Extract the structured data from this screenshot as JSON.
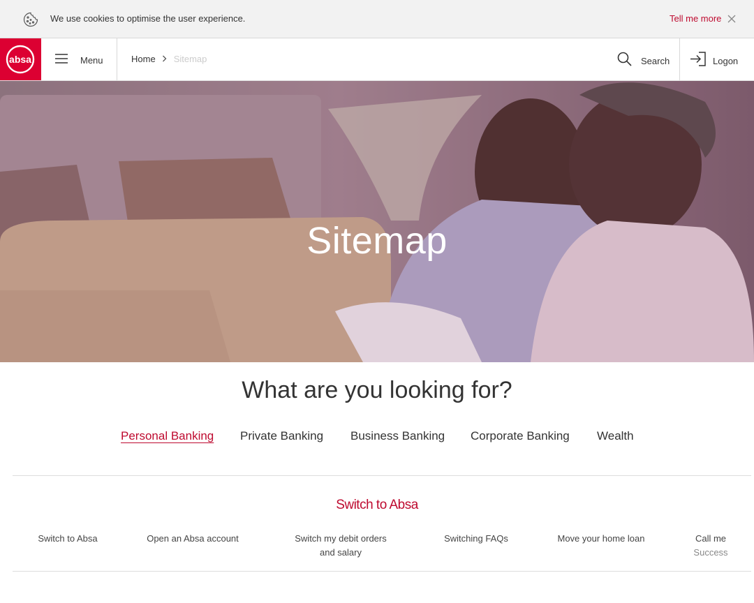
{
  "cookie": {
    "message": "We use cookies to optimise the user experience.",
    "tell_more": "Tell me more"
  },
  "header": {
    "logo_text": "absa",
    "menu_label": "Menu",
    "breadcrumb": {
      "home": "Home",
      "current": "Sitemap"
    },
    "search_label": "Search",
    "logon_label": "Logon"
  },
  "hero": {
    "title": "Sitemap"
  },
  "main": {
    "heading": "What are you looking for?",
    "tabs": [
      {
        "label": "Personal Banking",
        "active": true
      },
      {
        "label": "Private Banking",
        "active": false
      },
      {
        "label": "Business Banking",
        "active": false
      },
      {
        "label": "Corporate Banking",
        "active": false
      },
      {
        "label": "Wealth",
        "active": false
      }
    ],
    "section": {
      "title": "Switch to Absa",
      "links": [
        {
          "label": "Switch to Absa"
        },
        {
          "label": "Open an Absa account"
        },
        {
          "label": "Switch my debit orders",
          "label2": "and salary"
        },
        {
          "label": "Switching FAQs"
        },
        {
          "label": "Move your home loan"
        },
        {
          "label": "Call me",
          "sub": "Success"
        }
      ]
    }
  },
  "colors": {
    "brand_red": "#dc0032",
    "link_red": "#be0a2f"
  }
}
